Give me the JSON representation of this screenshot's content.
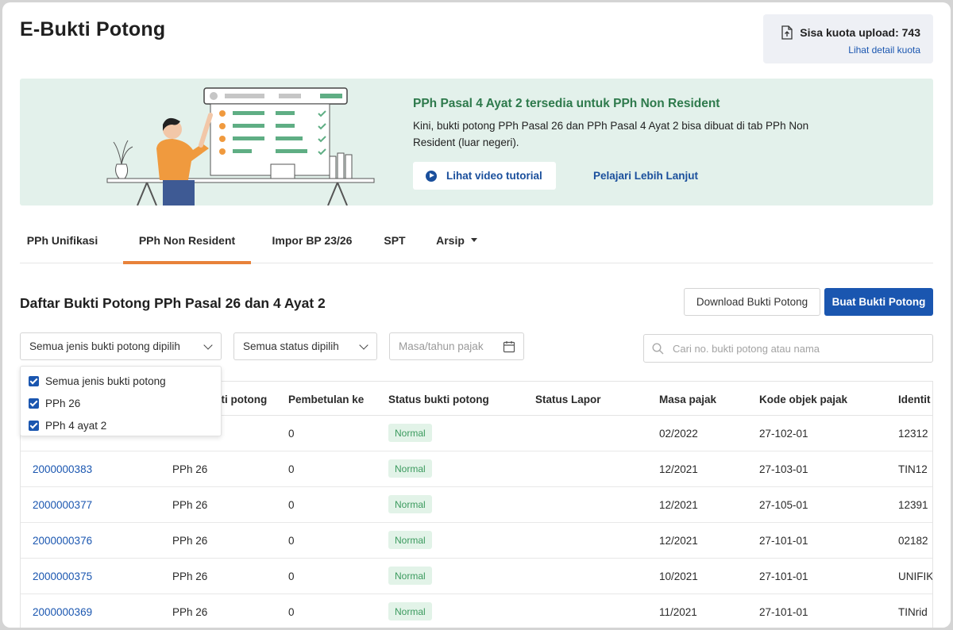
{
  "page": {
    "title": "E-Bukti Potong"
  },
  "quota": {
    "text": "Sisa kuota upload: 743",
    "link": "Lihat detail kuota",
    "icon": "upload-file-icon"
  },
  "banner": {
    "title": "PPh Pasal 4 Ayat 2 tersedia untuk PPh Non Resident",
    "description": "Kini, bukti potong PPh Pasal 26 dan PPh Pasal 4 Ayat 2 bisa dibuat di tab PPh Non Resident (luar negeri).",
    "video_button": "Lihat video tutorial",
    "learn_more": "Pelajari Lebih Lanjut",
    "colors": {
      "background": "#e3f1eb",
      "title": "#2e7a4c"
    }
  },
  "tabs": [
    {
      "label": "PPh Unifikasi",
      "active": false
    },
    {
      "label": "PPh Non Resident",
      "active": true
    },
    {
      "label": "Impor BP 23/26",
      "active": false
    },
    {
      "label": "SPT",
      "active": false
    },
    {
      "label": "Arsip",
      "active": false,
      "has_dropdown": true
    }
  ],
  "list": {
    "title": "Daftar Bukti Potong PPh Pasal 26 dan 4 Ayat 2",
    "download_button": "Download Bukti Potong",
    "create_button": "Buat Bukti Potong"
  },
  "filters": {
    "type": "Semua jenis bukti potong dipilih",
    "status": "Semua status dipilih",
    "date_placeholder": "Masa/tahun pajak",
    "search_placeholder": "Cari no. bukti potong atau nama"
  },
  "type_dropdown": {
    "options": [
      {
        "label": "Semua jenis bukti potong",
        "checked": true
      },
      {
        "label": "PPh 26",
        "checked": true
      },
      {
        "label": "PPh 4 ayat 2",
        "checked": true
      }
    ]
  },
  "table": {
    "headers": [
      "kti potong",
      "Pembetulan ke",
      "Status bukti potong",
      "Status Lapor",
      "Masa pajak",
      "Kode objek pajak",
      "Identit"
    ],
    "rows": [
      {
        "no": "",
        "jenis": "",
        "pembetulan": "0",
        "status": "Normal",
        "lapor": "",
        "masa": "02/2022",
        "kode": "27-102-01",
        "identitas": "12312"
      },
      {
        "no": "2000000383",
        "jenis": "PPh 26",
        "pembetulan": "0",
        "status": "Normal",
        "lapor": "",
        "masa": "12/2021",
        "kode": "27-103-01",
        "identitas": "TIN12"
      },
      {
        "no": "2000000377",
        "jenis": "PPh 26",
        "pembetulan": "0",
        "status": "Normal",
        "lapor": "",
        "masa": "12/2021",
        "kode": "27-105-01",
        "identitas": "12391"
      },
      {
        "no": "2000000376",
        "jenis": "PPh 26",
        "pembetulan": "0",
        "status": "Normal",
        "lapor": "",
        "masa": "12/2021",
        "kode": "27-101-01",
        "identitas": "02182"
      },
      {
        "no": "2000000375",
        "jenis": "PPh 26",
        "pembetulan": "0",
        "status": "Normal",
        "lapor": "",
        "masa": "10/2021",
        "kode": "27-101-01",
        "identitas": "UNIFIK"
      },
      {
        "no": "2000000369",
        "jenis": "PPh 26",
        "pembetulan": "0",
        "status": "Normal",
        "lapor": "",
        "masa": "11/2021",
        "kode": "27-101-01",
        "identitas": "TINrid"
      }
    ]
  },
  "colors": {
    "primary": "#1a56b0",
    "tab_active": "#e8823a",
    "badge_bg": "#e2f3e8",
    "badge_text": "#3b9a5e"
  }
}
